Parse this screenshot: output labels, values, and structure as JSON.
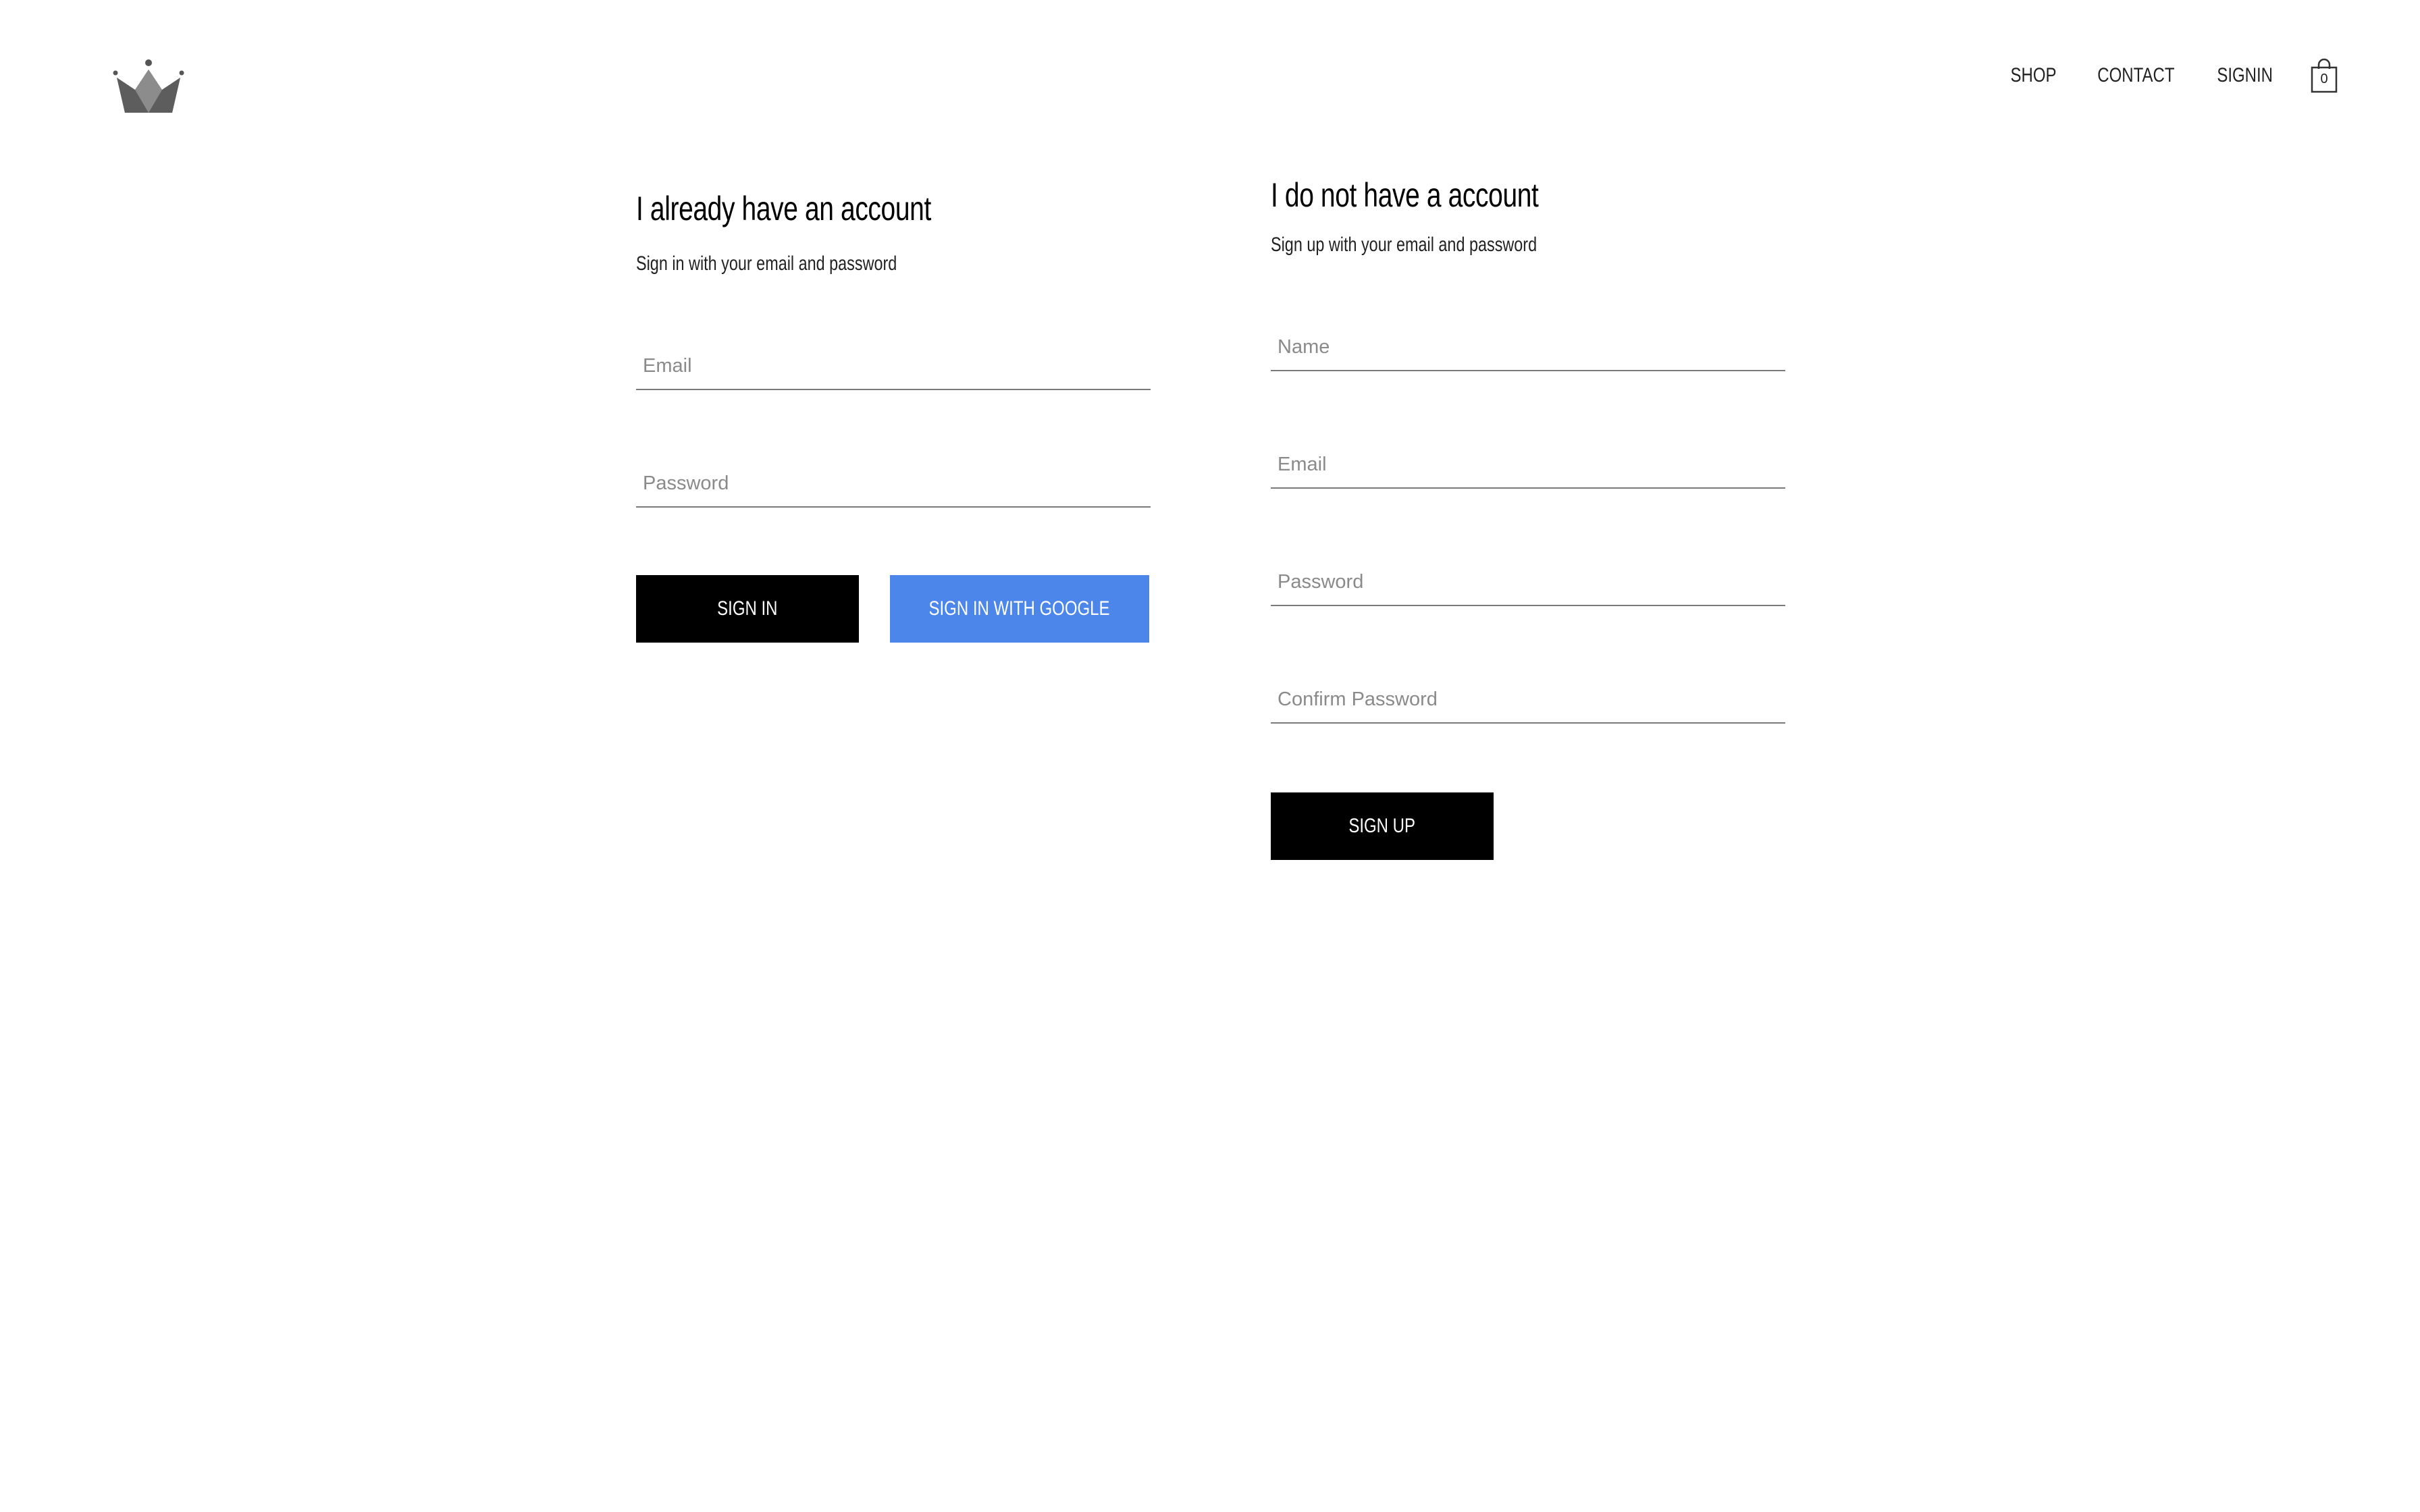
{
  "header": {
    "logo_icon": "crown-icon",
    "nav": [
      {
        "label": "SHOP"
      },
      {
        "label": "CONTACT"
      },
      {
        "label": "SIGNIN"
      }
    ],
    "cart": {
      "icon": "shopping-bag-icon",
      "count": "0"
    }
  },
  "signin": {
    "title": "I already have an account",
    "subtitle": "Sign in with your email and password",
    "email_placeholder": "Email",
    "password_placeholder": "Password",
    "signin_label": "SIGN IN",
    "google_label": "SIGN IN WITH GOOGLE"
  },
  "signup": {
    "title": "I do not have a account",
    "subtitle": "Sign up with your email and password",
    "name_placeholder": "Name",
    "email_placeholder": "Email",
    "password_placeholder": "Password",
    "confirm_placeholder": "Confirm Password",
    "signup_label": "SIGN UP"
  },
  "colors": {
    "primary_button": "#000000",
    "google_button": "#4c86ea",
    "underline": "#7a7a7a",
    "logo": "#666666"
  }
}
